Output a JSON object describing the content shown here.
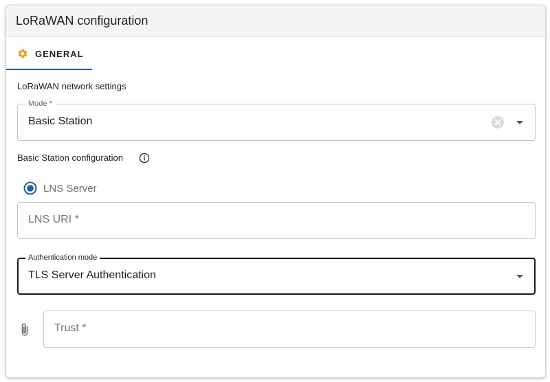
{
  "panel": {
    "title": "LoRaWAN configuration"
  },
  "tabs": [
    {
      "label": "GENERAL",
      "icon": "gear-icon",
      "active": true
    }
  ],
  "network_settings": {
    "label": "LoRaWAN network settings",
    "mode": {
      "legend": "Mode *",
      "value": "Basic Station"
    }
  },
  "basic_station": {
    "label": "Basic Station configuration",
    "radio": {
      "label": "LNS Server",
      "checked": true
    },
    "lns_uri": {
      "placeholder": "LNS URI *"
    },
    "auth_mode": {
      "legend": "Authentication mode",
      "value": "TLS Server Authentication"
    },
    "trust": {
      "placeholder": "Trust *"
    }
  },
  "colors": {
    "accent": "#1f5ca8",
    "tab_icon": "#f0a020",
    "header_bg": "#f5f5f5"
  }
}
